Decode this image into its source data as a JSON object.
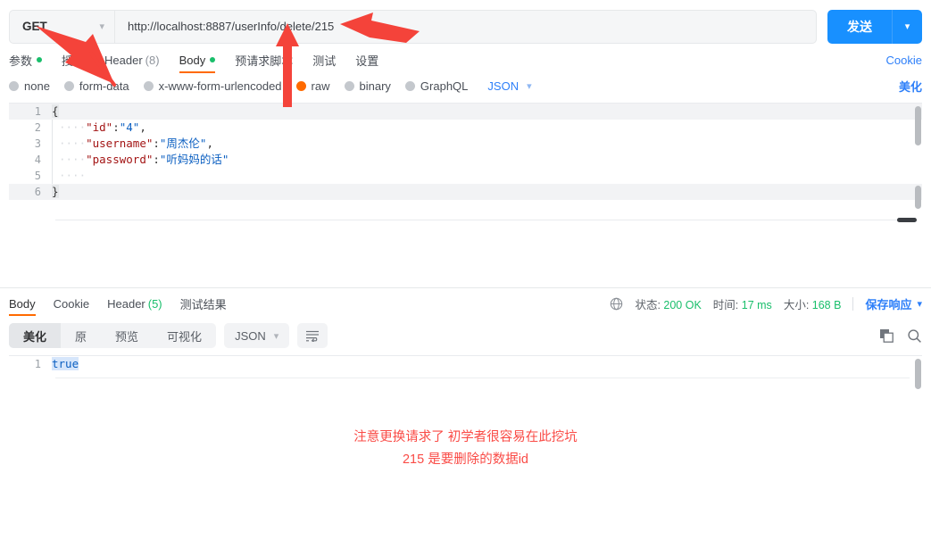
{
  "request": {
    "method": "GET",
    "url": "http://localhost:8887/userInfo/delete/215",
    "send_label": "发送",
    "cookie_link": "Cookie",
    "beautify_link": "美化",
    "tabs": [
      {
        "label": "参数",
        "dot": true,
        "active": false
      },
      {
        "label": "授权",
        "dot": false,
        "active": false
      },
      {
        "label": "Header",
        "count": "(8)",
        "dot": false,
        "active": false
      },
      {
        "label": "Body",
        "dot": true,
        "active": true
      },
      {
        "label": "预请求脚本",
        "dot": false,
        "active": false
      },
      {
        "label": "测试",
        "dot": false,
        "active": false
      },
      {
        "label": "设置",
        "dot": false,
        "active": false
      }
    ],
    "body_types": [
      {
        "label": "none",
        "selected": false
      },
      {
        "label": "form-data",
        "selected": false
      },
      {
        "label": "x-www-form-urlencoded",
        "selected": false
      },
      {
        "label": "raw",
        "selected": true
      },
      {
        "label": "binary",
        "selected": false
      },
      {
        "label": "GraphQL",
        "selected": false
      }
    ],
    "raw_format": "JSON",
    "body_lines": [
      {
        "n": "1",
        "brace": "{"
      },
      {
        "n": "2",
        "indent": "····",
        "key": "\"id\"",
        "colon": ":",
        "value": "\"4\"",
        "tail": ","
      },
      {
        "n": "3",
        "indent": "····",
        "key": "\"username\"",
        "colon": ":",
        "value": "\"周杰伦\"",
        "tail": ","
      },
      {
        "n": "4",
        "indent": "····",
        "key": "\"password\"",
        "colon": ":",
        "value": "\"听妈妈的话\"",
        "tail": ""
      },
      {
        "n": "5",
        "indent": "····",
        "key": "",
        "colon": "",
        "value": "",
        "tail": ""
      },
      {
        "n": "6",
        "brace": "}"
      }
    ]
  },
  "response": {
    "tabs": [
      {
        "label": "Body",
        "active": true
      },
      {
        "label": "Cookie",
        "active": false
      },
      {
        "label": "Header",
        "count": "(5)",
        "active": false
      },
      {
        "label": "测试结果",
        "active": false
      }
    ],
    "status_label": "状态:",
    "status_value": "200 OK",
    "time_label": "时间:",
    "time_value": "17 ms",
    "size_label": "大小:",
    "size_value": "168 B",
    "save_label": "保存响应",
    "view_modes": [
      {
        "label": "美化",
        "active": true
      },
      {
        "label": "原",
        "active": false
      },
      {
        "label": "预览",
        "active": false
      },
      {
        "label": "可视化",
        "active": false
      }
    ],
    "format": "JSON",
    "body_lines": [
      {
        "n": "1",
        "text": "true"
      }
    ]
  },
  "annotation": {
    "line1": "注意更换请求了 初学者很容易在此挖坑",
    "line2": "215 是要删除的数据id"
  },
  "colors": {
    "accent_blue": "#1890ff",
    "link_blue": "#2d7ff9",
    "active_orange": "#ff6a00",
    "success_green": "#19be6b",
    "annotation_red": "#fa4b46"
  }
}
